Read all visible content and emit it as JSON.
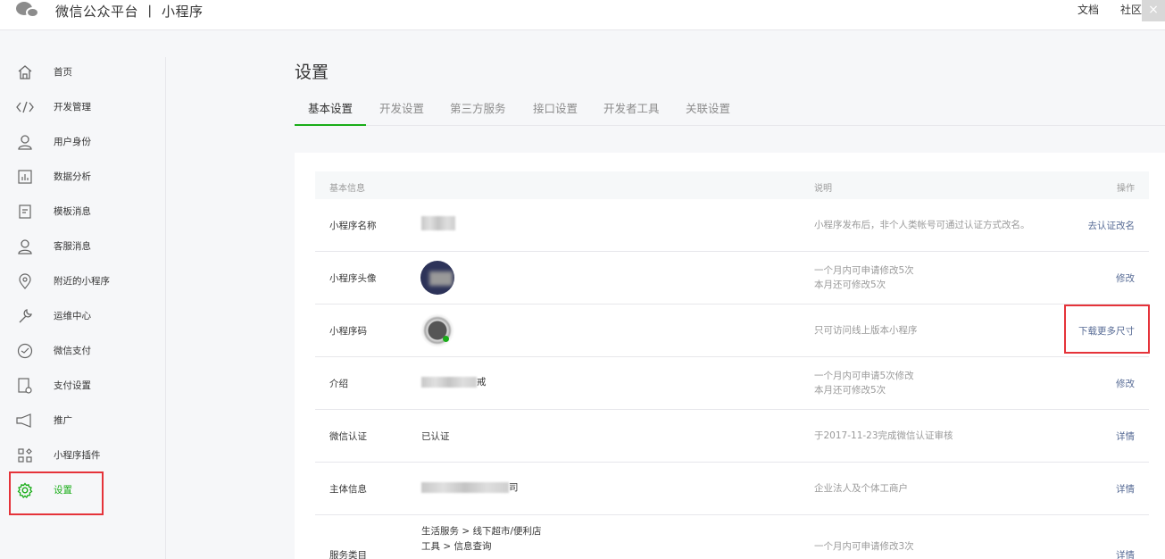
{
  "header": {
    "title": "微信公众平台 丨 小程序",
    "links": [
      "文档",
      "社区"
    ],
    "close_glyph": "×"
  },
  "sidebar": {
    "items": [
      {
        "label": "首页",
        "icon": "home-icon"
      },
      {
        "label": "开发管理",
        "icon": "code-icon"
      },
      {
        "label": "用户身份",
        "icon": "user-icon"
      },
      {
        "label": "数据分析",
        "icon": "chart-icon"
      },
      {
        "label": "模板消息",
        "icon": "document-icon"
      },
      {
        "label": "客服消息",
        "icon": "customer-service-icon"
      },
      {
        "label": "附近的小程序",
        "icon": "location-icon"
      },
      {
        "label": "运维中心",
        "icon": "wrench-icon"
      },
      {
        "label": "微信支付",
        "icon": "pay-icon"
      },
      {
        "label": "支付设置",
        "icon": "pay-settings-icon"
      },
      {
        "label": "推广",
        "icon": "megaphone-icon"
      },
      {
        "label": "小程序插件",
        "icon": "plugin-icon"
      },
      {
        "label": "设置",
        "icon": "gear-icon",
        "active": true
      }
    ]
  },
  "main": {
    "title": "设置",
    "tabs": [
      "基本设置",
      "开发设置",
      "第三方服务",
      "接口设置",
      "开发者工具",
      "关联设置"
    ],
    "active_tab": "基本设置",
    "table": {
      "headers": [
        "基本信息",
        "说明",
        "操作"
      ],
      "rows": [
        {
          "name": "小程序名称",
          "value": "",
          "desc1": "小程序发布后，非个人类帐号可通过认证方式改名。",
          "desc2": "",
          "op": "去认证改名"
        },
        {
          "name": "小程序头像",
          "value": "",
          "desc1": "一个月内可申请修改5次",
          "desc2": "本月还可修改5次",
          "op": "修改"
        },
        {
          "name": "小程序码",
          "value": "",
          "desc1": "只可访问线上版本小程序",
          "desc2": "",
          "op": "下载更多尺寸"
        },
        {
          "name": "介绍",
          "value": "戒",
          "desc1": "一个月内可申请5次修改",
          "desc2": "本月还可修改5次",
          "op": "修改"
        },
        {
          "name": "微信认证",
          "value": "已认证",
          "desc1": "于2017-11-23完成微信认证审核",
          "desc2": "",
          "op": "详情"
        },
        {
          "name": "主体信息",
          "value": "司",
          "desc1": "企业法人及个体工商户",
          "desc2": "",
          "op": "详情"
        },
        {
          "name": "服务类目",
          "value_lines": [
            "生活服务 > 线下超市/便利店",
            "工具 > 信息查询"
          ],
          "desc1": "一个月内可申请修改3次",
          "desc2": "",
          "op": "详情"
        }
      ]
    }
  },
  "colors": {
    "accent": "#1aad19",
    "link": "#576b95",
    "highlight": "#e5333a"
  }
}
